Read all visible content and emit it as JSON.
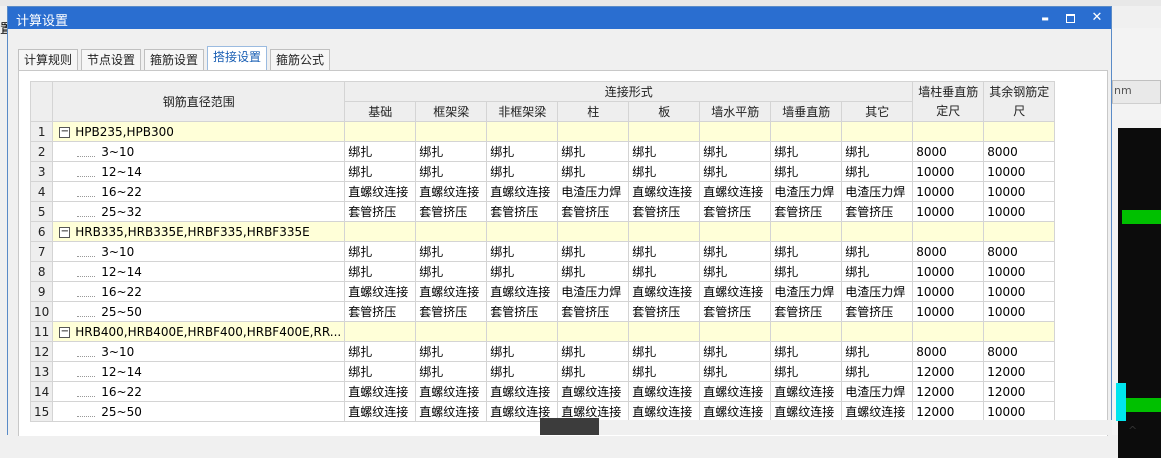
{
  "window": {
    "title": "计算设置",
    "minimize_glyph": "▬",
    "close_glyph": "✕"
  },
  "background": {
    "tab_text": "nm",
    "left_glyph": "置",
    "small_text": "",
    "corner_glyph": "^"
  },
  "tabs": [
    {
      "label": "计算规则",
      "active": false
    },
    {
      "label": "节点设置",
      "active": false
    },
    {
      "label": "箍筋设置",
      "active": false
    },
    {
      "label": "搭接设置",
      "active": true
    },
    {
      "label": "箍筋公式",
      "active": false
    }
  ],
  "grid": {
    "header_range": "钢筋直径范围",
    "header_group": "连接形式",
    "header_cols": [
      "基础",
      "框架梁",
      "非框架梁",
      "柱",
      "板",
      "墙水平筋",
      "墙垂直筋",
      "其它"
    ],
    "header_col_vertical": "墙柱垂直筋定尺",
    "header_col_other": "其余钢筋定尺",
    "toggle_glyph": "−",
    "rows": [
      {
        "n": "1",
        "group": true,
        "label": "HPB235,HPB300"
      },
      {
        "n": "2",
        "label": "3~10",
        "cells": [
          "绑扎",
          "绑扎",
          "绑扎",
          "绑扎",
          "绑扎",
          "绑扎",
          "绑扎",
          "绑扎",
          "8000",
          "8000"
        ]
      },
      {
        "n": "3",
        "label": "12~14",
        "cells": [
          "绑扎",
          "绑扎",
          "绑扎",
          "绑扎",
          "绑扎",
          "绑扎",
          "绑扎",
          "绑扎",
          "10000",
          "10000"
        ]
      },
      {
        "n": "4",
        "label": "16~22",
        "cells": [
          "直螺纹连接",
          "直螺纹连接",
          "直螺纹连接",
          "电渣压力焊",
          "直螺纹连接",
          "直螺纹连接",
          "电渣压力焊",
          "电渣压力焊",
          "10000",
          "10000"
        ]
      },
      {
        "n": "5",
        "label": "25~32",
        "cells": [
          "套管挤压",
          "套管挤压",
          "套管挤压",
          "套管挤压",
          "套管挤压",
          "套管挤压",
          "套管挤压",
          "套管挤压",
          "10000",
          "10000"
        ]
      },
      {
        "n": "6",
        "group": true,
        "label": "HRB335,HRB335E,HRBF335,HRBF335E"
      },
      {
        "n": "7",
        "label": "3~10",
        "cells": [
          "绑扎",
          "绑扎",
          "绑扎",
          "绑扎",
          "绑扎",
          "绑扎",
          "绑扎",
          "绑扎",
          "8000",
          "8000"
        ]
      },
      {
        "n": "8",
        "label": "12~14",
        "cells": [
          "绑扎",
          "绑扎",
          "绑扎",
          "绑扎",
          "绑扎",
          "绑扎",
          "绑扎",
          "绑扎",
          "10000",
          "10000"
        ]
      },
      {
        "n": "9",
        "label": "16~22",
        "cells": [
          "直螺纹连接",
          "直螺纹连接",
          "直螺纹连接",
          "电渣压力焊",
          "直螺纹连接",
          "直螺纹连接",
          "电渣压力焊",
          "电渣压力焊",
          "10000",
          "10000"
        ]
      },
      {
        "n": "10",
        "label": "25~50",
        "cells": [
          "套管挤压",
          "套管挤压",
          "套管挤压",
          "套管挤压",
          "套管挤压",
          "套管挤压",
          "套管挤压",
          "套管挤压",
          "10000",
          "10000"
        ]
      },
      {
        "n": "11",
        "group": true,
        "label": "HRB400,HRB400E,HRBF400,HRBF400E,RR..."
      },
      {
        "n": "12",
        "label": "3~10",
        "cells": [
          "绑扎",
          "绑扎",
          "绑扎",
          "绑扎",
          "绑扎",
          "绑扎",
          "绑扎",
          "绑扎",
          "8000",
          "8000"
        ]
      },
      {
        "n": "13",
        "label": "12~14",
        "cells": [
          "绑扎",
          "绑扎",
          "绑扎",
          "绑扎",
          "绑扎",
          "绑扎",
          "绑扎",
          "绑扎",
          "12000",
          "12000"
        ]
      },
      {
        "n": "14",
        "label": "16~22",
        "cells": [
          "直螺纹连接",
          "直螺纹连接",
          "直螺纹连接",
          "直螺纹连接",
          "直螺纹连接",
          "直螺纹连接",
          "直螺纹连接",
          "电渣压力焊",
          "12000",
          "12000"
        ]
      },
      {
        "n": "15",
        "label": "25~50",
        "cells": [
          "直螺纹连接",
          "直螺纹连接",
          "直螺纹连接",
          "直螺纹连接",
          "直螺纹连接",
          "直螺纹连接",
          "直螺纹连接",
          "直螺纹连接",
          "12000",
          "10000"
        ]
      }
    ]
  }
}
